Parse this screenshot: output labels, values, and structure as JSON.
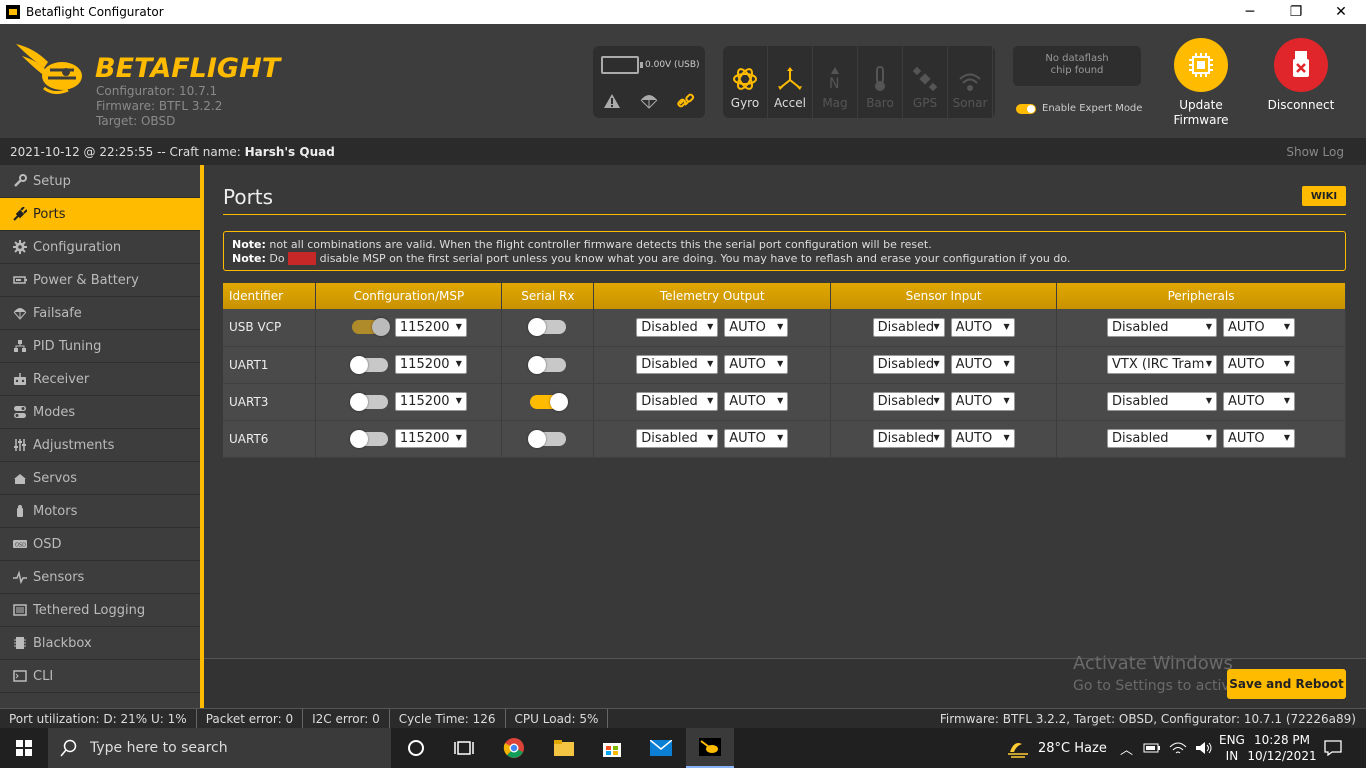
{
  "window": {
    "title": "Betaflight Configurator",
    "minimize": "─",
    "maximize": "❐",
    "close": "✕"
  },
  "header": {
    "brand": "BETAFLIGHT",
    "configurator": "Configurator: 10.7.1",
    "firmware": "Firmware: BTFL 3.2.2",
    "target": "Target: OBSD",
    "battery": "0.00V (USB)",
    "sensors": [
      {
        "label": "Gyro",
        "icon": "gyro-icon",
        "active": true
      },
      {
        "label": "Accel",
        "icon": "accel-icon",
        "active": true
      },
      {
        "label": "Mag",
        "icon": "mag-icon",
        "active": false
      },
      {
        "label": "Baro",
        "icon": "baro-icon",
        "active": false
      },
      {
        "label": "GPS",
        "icon": "gps-icon",
        "active": false
      },
      {
        "label": "Sonar",
        "icon": "sonar-icon",
        "active": false
      }
    ],
    "dataflash_line1": "No dataflash",
    "dataflash_line2": "chip found",
    "expert_mode": "Enable Expert Mode",
    "update_firmware_1": "Update",
    "update_firmware_2": "Firmware",
    "disconnect": "Disconnect"
  },
  "statusline": {
    "datetime": "2021-10-12 @ 22:25:55 -- Craft name: ",
    "craft_name": "Harsh's Quad",
    "show_log": "Show Log"
  },
  "sidebar": {
    "items": [
      {
        "label": "Setup",
        "icon": "wrench-icon"
      },
      {
        "label": "Ports",
        "icon": "plug-icon"
      },
      {
        "label": "Configuration",
        "icon": "gear-icon"
      },
      {
        "label": "Power & Battery",
        "icon": "battery-icon"
      },
      {
        "label": "Failsafe",
        "icon": "parachute-icon"
      },
      {
        "label": "PID Tuning",
        "icon": "pid-icon"
      },
      {
        "label": "Receiver",
        "icon": "receiver-icon"
      },
      {
        "label": "Modes",
        "icon": "modes-icon"
      },
      {
        "label": "Adjustments",
        "icon": "sliders-icon"
      },
      {
        "label": "Servos",
        "icon": "servo-icon"
      },
      {
        "label": "Motors",
        "icon": "motor-icon"
      },
      {
        "label": "OSD",
        "icon": "osd-icon"
      },
      {
        "label": "Sensors",
        "icon": "pulse-icon"
      },
      {
        "label": "Tethered Logging",
        "icon": "log-icon"
      },
      {
        "label": "Blackbox",
        "icon": "blackbox-icon"
      },
      {
        "label": "CLI",
        "icon": "terminal-icon"
      }
    ]
  },
  "main": {
    "title": "Ports",
    "wiki": "WIKI",
    "note1_bold": "Note:",
    "note1": " not all combinations are valid. When the flight controller firmware detects this the serial port configuration will be reset.",
    "note2_bold": "Note:",
    "note2_pre": " Do ",
    "note2_never": "NOT",
    "note2_post": " disable MSP on the first serial port unless you know what you are doing. You may have to reflash and erase your configuration if you do.",
    "columns": [
      "Identifier",
      "Configuration/MSP",
      "Serial Rx",
      "Telemetry Output",
      "Sensor Input",
      "Peripherals"
    ],
    "rows": [
      {
        "id": "USB VCP",
        "msp": "dim",
        "baud": "115200",
        "rx": false,
        "tel": "Disabled",
        "tel_baud": "AUTO",
        "sen": "Disabled",
        "sen_baud": "AUTO",
        "per": "Disabled",
        "per_baud": "AUTO"
      },
      {
        "id": "UART1",
        "msp": "off",
        "baud": "115200",
        "rx": false,
        "tel": "Disabled",
        "tel_baud": "AUTO",
        "sen": "Disabled",
        "sen_baud": "AUTO",
        "per": "VTX (IRC Tram",
        "per_baud": "AUTO"
      },
      {
        "id": "UART3",
        "msp": "off",
        "baud": "115200",
        "rx": true,
        "tel": "Disabled",
        "tel_baud": "AUTO",
        "sen": "Disabled",
        "sen_baud": "AUTO",
        "per": "Disabled",
        "per_baud": "AUTO"
      },
      {
        "id": "UART6",
        "msp": "off",
        "baud": "115200",
        "rx": false,
        "tel": "Disabled",
        "tel_baud": "AUTO",
        "sen": "Disabled",
        "sen_baud": "AUTO",
        "per": "Disabled",
        "per_baud": "AUTO"
      }
    ],
    "save_button": "Save and Reboot",
    "activate1": "Activate Windows",
    "activate2": "Go to Settings to activa"
  },
  "bottombar": {
    "port_util": "Port utilization: D: 21% U: 1%",
    "packet_error": "Packet error: 0",
    "i2c_error": "I2C error: 0",
    "cycle_time": "Cycle Time: 126",
    "cpu_load": "CPU Load: 5%",
    "firmware_info": "Firmware: BTFL 3.2.2, Target: OBSD, Configurator: 10.7.1 (72226a89)"
  },
  "taskbar": {
    "search_placeholder": "Type here to search",
    "weather": "28°C  Haze",
    "lang1": "ENG",
    "lang2": "IN",
    "time": "10:28 PM",
    "date": "10/12/2021"
  },
  "colors": {
    "accent": "#ffbb00",
    "header_bg": "#3d3d3d",
    "disconnect": "#e0262a"
  }
}
